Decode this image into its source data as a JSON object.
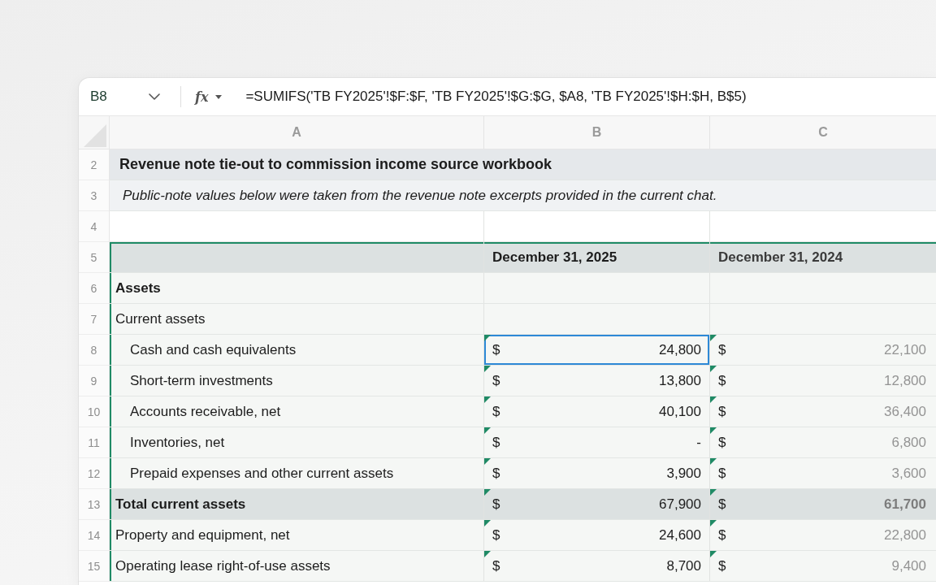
{
  "formula_bar": {
    "cell_reference": "B8",
    "function_label": "fx",
    "formula": "=SUMIFS('TB FY2025'!$F:$F, 'TB FY2025'!$G:$G, $A8, 'TB FY2025'!$H:$H, B$5)"
  },
  "columns": [
    "A",
    "B",
    "C"
  ],
  "rows": [
    {
      "number": "2",
      "kind": "title",
      "in_selection": false,
      "label": "Revenue note tie-out to commission income source workbook"
    },
    {
      "number": "3",
      "kind": "note",
      "in_selection": false,
      "label": "Public-note values below were taken from the revenue note excerpts provided in the current chat."
    },
    {
      "number": "4",
      "kind": "blank",
      "in_selection": false
    },
    {
      "number": "5",
      "kind": "header",
      "in_selection": true,
      "b": {
        "text": "December 31, 2025",
        "selected": false
      },
      "c": {
        "text": "December 31, 2024",
        "selected": false
      }
    },
    {
      "number": "6",
      "kind": "section",
      "in_selection": true,
      "label": "Assets"
    },
    {
      "number": "7",
      "kind": "group",
      "in_selection": true,
      "label": "Current assets"
    },
    {
      "number": "8",
      "kind": "detail",
      "in_selection": true,
      "label": "Cash and cash equivalents",
      "b": {
        "currency": "$",
        "value": "24,800",
        "flagged": true,
        "selected": true
      },
      "c": {
        "currency": "$",
        "value": "22,100",
        "flagged": true,
        "selected": false
      }
    },
    {
      "number": "9",
      "kind": "detail",
      "in_selection": true,
      "label": "Short-term investments",
      "b": {
        "currency": "$",
        "value": "13,800",
        "flagged": true,
        "selected": false
      },
      "c": {
        "currency": "$",
        "value": "12,800",
        "flagged": true,
        "selected": false
      }
    },
    {
      "number": "10",
      "kind": "detail",
      "in_selection": true,
      "label": "Accounts receivable, net",
      "b": {
        "currency": "$",
        "value": "40,100",
        "flagged": true,
        "selected": false
      },
      "c": {
        "currency": "$",
        "value": "36,400",
        "flagged": true,
        "selected": false
      }
    },
    {
      "number": "11",
      "kind": "detail",
      "in_selection": true,
      "label": "Inventories, net",
      "b": {
        "currency": "$",
        "value": "-",
        "flagged": true,
        "selected": false
      },
      "c": {
        "currency": "$",
        "value": "6,800",
        "flagged": true,
        "selected": false
      }
    },
    {
      "number": "12",
      "kind": "detail",
      "in_selection": true,
      "label": "Prepaid expenses and other current assets",
      "b": {
        "currency": "$",
        "value": "3,900",
        "flagged": true,
        "selected": false
      },
      "c": {
        "currency": "$",
        "value": "3,600",
        "flagged": true,
        "selected": false
      }
    },
    {
      "number": "13",
      "kind": "total",
      "in_selection": true,
      "label": "Total current assets",
      "b": {
        "currency": "$",
        "value": "67,900",
        "flagged": true,
        "selected": false
      },
      "c": {
        "currency": "$",
        "value": "61,700",
        "flagged": true,
        "selected": false
      }
    },
    {
      "number": "14",
      "kind": "line",
      "in_selection": true,
      "label": "Property and equipment, net",
      "b": {
        "currency": "$",
        "value": "24,600",
        "flagged": true,
        "selected": false
      },
      "c": {
        "currency": "$",
        "value": "22,800",
        "flagged": true,
        "selected": false
      }
    },
    {
      "number": "15",
      "kind": "line",
      "in_selection": true,
      "label": "Operating lease right-of-use assets",
      "b": {
        "currency": "$",
        "value": "8,700",
        "flagged": true,
        "selected": false
      },
      "c": {
        "currency": "$",
        "value": "9,400",
        "flagged": true,
        "selected": false
      }
    }
  ]
}
